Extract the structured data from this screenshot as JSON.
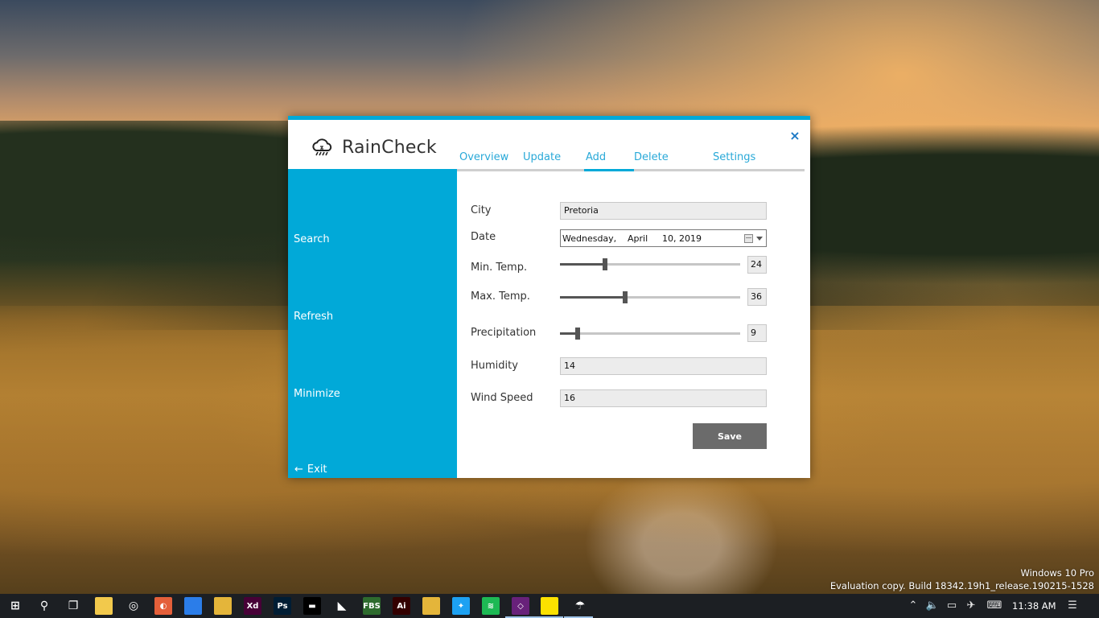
{
  "app": {
    "title": "RainCheck",
    "close_glyph": "×",
    "accent_color": "#01a9d8"
  },
  "tabs": [
    {
      "label": "Overview",
      "active": false
    },
    {
      "label": "Update",
      "active": false
    },
    {
      "label": "Add",
      "active": true
    },
    {
      "label": "Delete",
      "active": false
    },
    {
      "label": "Settings",
      "active": false
    }
  ],
  "sidebar": {
    "items": [
      {
        "label": "Search"
      },
      {
        "label": "Refresh"
      },
      {
        "label": "Minimize"
      }
    ],
    "exit_label": "Exit",
    "exit_icon": "arrow-left-icon"
  },
  "form": {
    "city": {
      "label": "City",
      "value": "Pretoria"
    },
    "date": {
      "label": "Date",
      "weekday": "Wednesday,",
      "month": "April",
      "day_year": "10, 2019"
    },
    "min_temp": {
      "label": "Min. Temp.",
      "value": "24",
      "level": 0.25
    },
    "max_temp": {
      "label": "Max. Temp.",
      "value": "36",
      "level": 0.36
    },
    "precipitation": {
      "label": "Precipitation",
      "value": "9",
      "level": 0.1
    },
    "humidity": {
      "label": "Humidity",
      "value": "14"
    },
    "wind_speed": {
      "label": "Wind Speed",
      "value": "16"
    },
    "save_label": "Save"
  },
  "watermark": {
    "line1": "Windows 10 Pro",
    "line2": "Evaluation copy. Build 18342.19h1_release.190215-1528"
  },
  "taskbar": {
    "apps": [
      {
        "name": "windows-start-icon",
        "glyph": "⊞",
        "bg": "transparent"
      },
      {
        "name": "search-icon",
        "glyph": "⚲",
        "bg": "transparent"
      },
      {
        "name": "task-view-icon",
        "glyph": "❐",
        "bg": "transparent"
      },
      {
        "name": "file-explorer-icon",
        "glyph": "",
        "bg": "#f2c94c"
      },
      {
        "name": "media-player-icon",
        "glyph": "◎",
        "bg": "transparent"
      },
      {
        "name": "edge-icon",
        "glyph": "◐",
        "bg": "#e45f3a"
      },
      {
        "name": "firefox-icon",
        "glyph": "",
        "bg": "#2b7de9"
      },
      {
        "name": "chrome-icon",
        "glyph": "",
        "bg": "#e4b53a"
      },
      {
        "name": "adobe-xd-icon",
        "glyph": "Xd",
        "bg": "#470137"
      },
      {
        "name": "photoshop-icon",
        "glyph": "Ps",
        "bg": "#001d34"
      },
      {
        "name": "terminal-icon",
        "glyph": "▬",
        "bg": "#000000"
      },
      {
        "name": "vscode-icon",
        "glyph": "◣",
        "bg": "transparent"
      },
      {
        "name": "fbs-icon",
        "glyph": "FBS",
        "bg": "#2e6b2e"
      },
      {
        "name": "illustrator-icon",
        "glyph": "Ai",
        "bg": "#330000"
      },
      {
        "name": "chrome-icon-2",
        "glyph": "",
        "bg": "#e4b53a"
      },
      {
        "name": "twitter-icon",
        "glyph": "✦",
        "bg": "#1da1f2"
      },
      {
        "name": "spotify-icon",
        "glyph": "≋",
        "bg": "#1db954"
      },
      {
        "name": "visual-studio-icon",
        "glyph": "◇",
        "bg": "#68217a"
      },
      {
        "name": "sticky-notes-icon",
        "glyph": "",
        "bg": "#fce100"
      },
      {
        "name": "raincheck-icon",
        "glyph": "☂",
        "bg": "transparent"
      }
    ],
    "tray": {
      "chevron_icon": "chevron-up-icon",
      "volume_icon": "volume-icon",
      "battery_icon": "battery-icon",
      "airplane_icon": "airplane-icon",
      "keyboard_icon": "keyboard-icon",
      "notifications_icon": "notifications-icon"
    },
    "clock": "11:38 AM"
  }
}
